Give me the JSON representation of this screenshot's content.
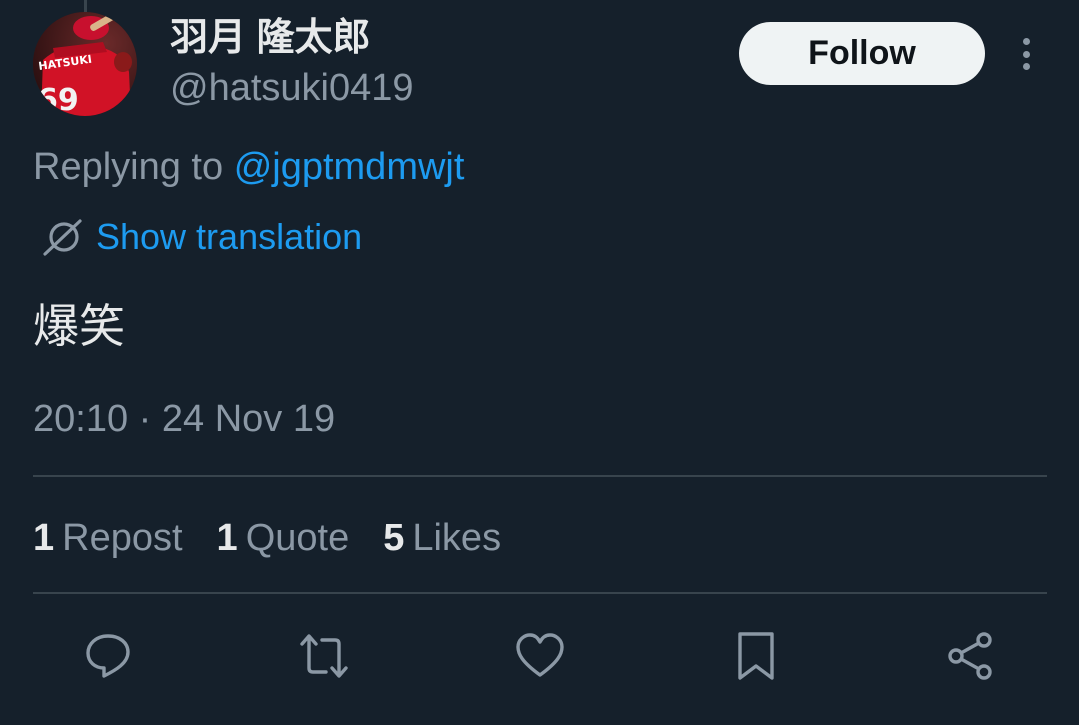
{
  "author": {
    "display_name": "羽月 隆太郎",
    "handle": "@hatsuki0419",
    "avatar_text": "HATSUKI",
    "avatar_number": "69"
  },
  "header": {
    "follow_label": "Follow",
    "more_icon": "more-vertical-icon"
  },
  "reply": {
    "prefix": "Replying to",
    "target": "@jgptmdmwjt"
  },
  "translation": {
    "icon": "translate-icon",
    "label": "Show translation"
  },
  "tweet": {
    "text": "爆笑",
    "timestamp": "20:10 · 24 Nov 19"
  },
  "stats": [
    {
      "count": "1",
      "label": "Repost"
    },
    {
      "count": "1",
      "label": "Quote"
    },
    {
      "count": "5",
      "label": "Likes"
    }
  ],
  "actions": [
    {
      "name": "reply-icon"
    },
    {
      "name": "repost-icon"
    },
    {
      "name": "like-icon"
    },
    {
      "name": "bookmark-icon"
    },
    {
      "name": "share-icon"
    }
  ],
  "colors": {
    "background": "#15202b",
    "text_primary": "#e7e9ea",
    "text_secondary": "#8b98a5",
    "accent": "#1d9bf0",
    "divider": "#38444d",
    "follow_bg": "#eff3f4"
  }
}
